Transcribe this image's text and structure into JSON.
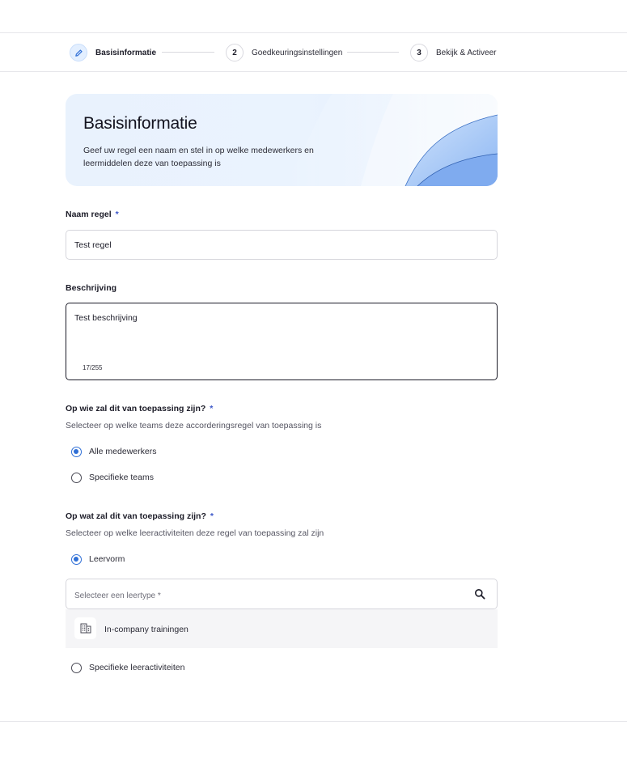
{
  "stepper": {
    "steps": [
      {
        "number": "",
        "label": "Basisinformatie"
      },
      {
        "number": "2",
        "label": "Goedkeuringsinstellingen"
      },
      {
        "number": "3",
        "label": "Bekijk & Activeer"
      }
    ]
  },
  "banner": {
    "title": "Basisinformatie",
    "subtitle": "Geef uw regel een naam en stel in op welke medewerkers en leermiddelen deze van toepassing is"
  },
  "name_field": {
    "label": "Naam regel",
    "required_mark": "*",
    "value": "Test regel"
  },
  "description_field": {
    "label": "Beschrijving",
    "value": "Test beschrijving",
    "counter": "17/255"
  },
  "who_section": {
    "title": "Op wie zal dit van toepassing zijn?",
    "required_mark": "*",
    "help": "Selecteer op welke teams deze accorderingsregel van toepassing is",
    "options": [
      {
        "label": "Alle medewerkers",
        "checked": true
      },
      {
        "label": "Specifieke teams",
        "checked": false
      }
    ]
  },
  "what_section": {
    "title": "Op wat zal dit van toepassing zijn?",
    "required_mark": "*",
    "help": "Selecteer op welke leeractiviteiten deze regel van toepassing zal zijn",
    "options": [
      {
        "label": "Leervorm",
        "checked": true
      },
      {
        "label": "Specifieke leeractiviteiten",
        "checked": false
      }
    ],
    "select_placeholder": "Selecteer een leertype *",
    "selected_items": [
      {
        "label": "In-company trainingen",
        "icon": "building-icon"
      }
    ]
  },
  "colors": {
    "accent": "#2f6fd6",
    "required": "#3b56c8",
    "banner_bg": "#e9f2fd"
  }
}
